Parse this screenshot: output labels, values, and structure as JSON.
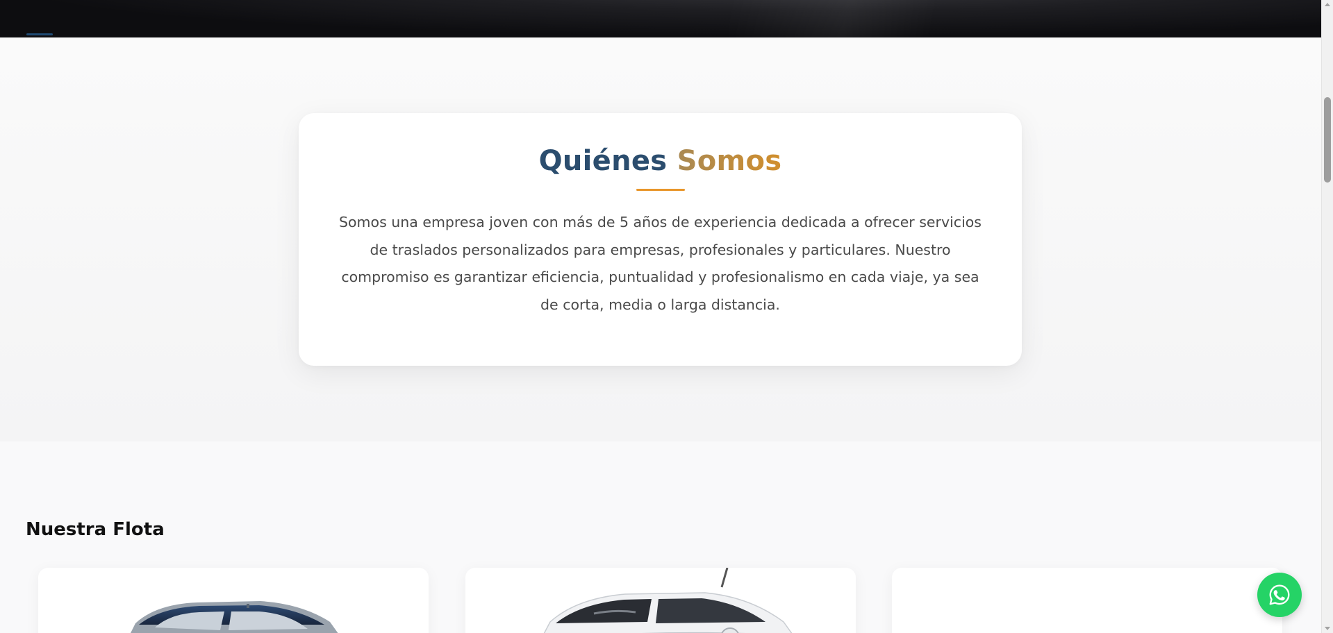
{
  "nav": {
    "menu_icon": "hamburger-icon"
  },
  "about": {
    "title_part1": "Quiénes",
    "title_part2": "Somos",
    "accent_color": "#e8962b",
    "title_color": "#2b4d6e",
    "body": "Somos una empresa joven con más de 5 años de experiencia dedicada a ofrecer servicios de traslados personalizados para empresas, profesionales y particulares. Nuestro compromiso es garantizar eficiencia, puntualidad y profesionalismo en cada viaje, ya sea de corta, media o larga distancia."
  },
  "fleet": {
    "title": "Nuestra Flota",
    "cars": [
      {
        "image": "dark-blue-sedan-image"
      },
      {
        "image": "white-sedan-image"
      },
      {
        "image": "car-image-not-visible"
      }
    ]
  },
  "whatsapp": {
    "icon": "whatsapp-icon",
    "color": "#25d366"
  }
}
